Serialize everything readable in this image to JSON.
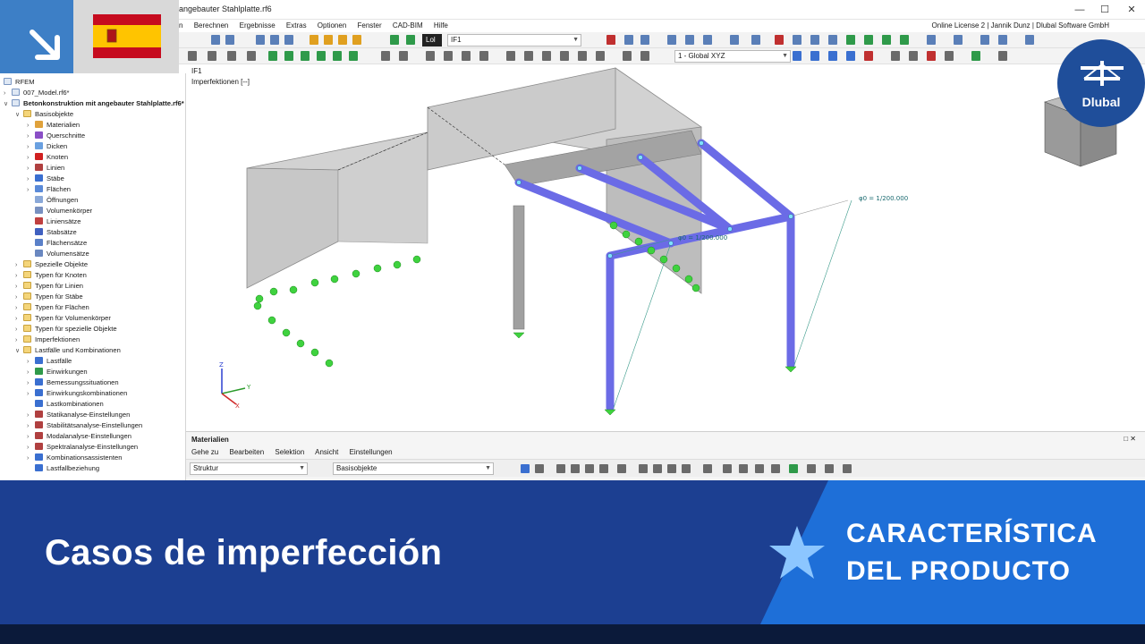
{
  "window": {
    "title": "angebauter Stahlplatte.rf6",
    "license": "Online License 2 | Jannik Dunz | Dlubal Software GmbH"
  },
  "menu": [
    "n",
    "Berechnen",
    "Ergebnisse",
    "Extras",
    "Optionen",
    "Fenster",
    "CAD-BIM",
    "Hilfe"
  ],
  "toolbar": {
    "lc_tag": "Lol",
    "lc_value": "IF1",
    "view_combo": "1 - Global XYZ"
  },
  "tree": {
    "root": "RFEM",
    "items": [
      {
        "label": "007_Model.rf6*",
        "level": 0,
        "kind": "file",
        "twisty": ">"
      },
      {
        "label": "Betonkonstruktion mit angebauter Stahlplatte.rf6*",
        "level": 0,
        "kind": "file",
        "twisty": "v",
        "bold": true
      },
      {
        "label": "Basisobjekte",
        "level": 1,
        "kind": "folder",
        "twisty": "v"
      },
      {
        "label": "Materialien",
        "level": 2,
        "kind": "item",
        "twisty": ">",
        "color": "#e0a23c"
      },
      {
        "label": "Querschnitte",
        "level": 2,
        "kind": "item",
        "twisty": ">",
        "color": "#8a4fc6"
      },
      {
        "label": "Dicken",
        "level": 2,
        "kind": "item",
        "twisty": ">",
        "color": "#6aa0e0"
      },
      {
        "label": "Knoten",
        "level": 2,
        "kind": "item",
        "twisty": ">",
        "color": "#d02020"
      },
      {
        "label": "Linien",
        "level": 2,
        "kind": "item",
        "twisty": ">",
        "color": "#b04040"
      },
      {
        "label": "Stäbe",
        "level": 2,
        "kind": "item",
        "twisty": ">",
        "color": "#3a6fd0"
      },
      {
        "label": "Flächen",
        "level": 2,
        "kind": "item",
        "twisty": ">",
        "color": "#5a8ad8"
      },
      {
        "label": "Öffnungen",
        "level": 2,
        "kind": "item",
        "twisty": "",
        "color": "#8aa8d8"
      },
      {
        "label": "Volumenkörper",
        "level": 2,
        "kind": "item",
        "twisty": "",
        "color": "#7890c0"
      },
      {
        "label": "Liniensätze",
        "level": 2,
        "kind": "item",
        "twisty": "",
        "color": "#c04040"
      },
      {
        "label": "Stabsätze",
        "level": 2,
        "kind": "item",
        "twisty": "",
        "color": "#4060c0"
      },
      {
        "label": "Flächensätze",
        "level": 2,
        "kind": "item",
        "twisty": "",
        "color": "#5a80c8"
      },
      {
        "label": "Volumensätze",
        "level": 2,
        "kind": "item",
        "twisty": "",
        "color": "#6a88c0"
      },
      {
        "label": "Spezielle Objekte",
        "level": 1,
        "kind": "folder",
        "twisty": ">"
      },
      {
        "label": "Typen für Knoten",
        "level": 1,
        "kind": "folder",
        "twisty": ">"
      },
      {
        "label": "Typen für Linien",
        "level": 1,
        "kind": "folder",
        "twisty": ">"
      },
      {
        "label": "Typen für Stäbe",
        "level": 1,
        "kind": "folder",
        "twisty": ">"
      },
      {
        "label": "Typen für Flächen",
        "level": 1,
        "kind": "folder",
        "twisty": ">"
      },
      {
        "label": "Typen für Volumenkörper",
        "level": 1,
        "kind": "folder",
        "twisty": ">"
      },
      {
        "label": "Typen für spezielle Objekte",
        "level": 1,
        "kind": "folder",
        "twisty": ">"
      },
      {
        "label": "Imperfektionen",
        "level": 1,
        "kind": "folder",
        "twisty": ">"
      },
      {
        "label": "Lastfälle und Kombinationen",
        "level": 1,
        "kind": "folder",
        "twisty": "v"
      },
      {
        "label": "Lastfälle",
        "level": 2,
        "kind": "item",
        "twisty": ">",
        "color": "#3a6fd0"
      },
      {
        "label": "Einwirkungen",
        "level": 2,
        "kind": "item",
        "twisty": ">",
        "color": "#2f9a4a"
      },
      {
        "label": "Bemessungssituationen",
        "level": 2,
        "kind": "item",
        "twisty": ">",
        "color": "#3a6fd0"
      },
      {
        "label": "Einwirkungskombinationen",
        "level": 2,
        "kind": "item",
        "twisty": ">",
        "color": "#3a6fd0"
      },
      {
        "label": "Lastkombinationen",
        "level": 2,
        "kind": "item",
        "twisty": "",
        "color": "#3a6fd0"
      },
      {
        "label": "Statikanalyse-Einstellungen",
        "level": 2,
        "kind": "item",
        "twisty": ">",
        "color": "#b04040"
      },
      {
        "label": "Stabilitätsanalyse-Einstellungen",
        "level": 2,
        "kind": "item",
        "twisty": ">",
        "color": "#b04040"
      },
      {
        "label": "Modalanalyse-Einstellungen",
        "level": 2,
        "kind": "item",
        "twisty": ">",
        "color": "#b04040"
      },
      {
        "label": "Spektralanalyse-Einstellungen",
        "level": 2,
        "kind": "item",
        "twisty": ">",
        "color": "#b04040"
      },
      {
        "label": "Kombinationsassistenten",
        "level": 2,
        "kind": "item",
        "twisty": ">",
        "color": "#3a6fd0"
      },
      {
        "label": "Lastfallbeziehung",
        "level": 2,
        "kind": "item",
        "twisty": "",
        "color": "#3a6fd0"
      }
    ]
  },
  "viewport": {
    "label1": "IF1",
    "label2": "Imperfektionen [--]",
    "annotation1": "φ0 = 1/200.000",
    "annotation2": "φ0 = 1/200.000",
    "axis_x": "X",
    "axis_y": "Y",
    "axis_z": "Z"
  },
  "panel": {
    "title": "Materialien",
    "menu": [
      "Gehe zu",
      "Bearbeiten",
      "Selektion",
      "Ansicht",
      "Einstellungen"
    ],
    "combo1": "Struktur",
    "combo2": "Basisobjekte"
  },
  "logo": {
    "text": "Dlubal"
  },
  "banner": {
    "title": "Casos de imperfección",
    "feature_line1": "CARACTERÍSTICA",
    "feature_line2": "DEL PRODUCTO"
  },
  "colors": {
    "banner_blue": "#1c3f91",
    "banner_light_blue": "#1e6fd8",
    "badge_blue": "#3d7fc6",
    "steel_members": "#7a7ae8",
    "support_green": "#3fd23f",
    "concrete_gray": "#c8c8c8",
    "logo_blue": "#1f4e9a"
  }
}
